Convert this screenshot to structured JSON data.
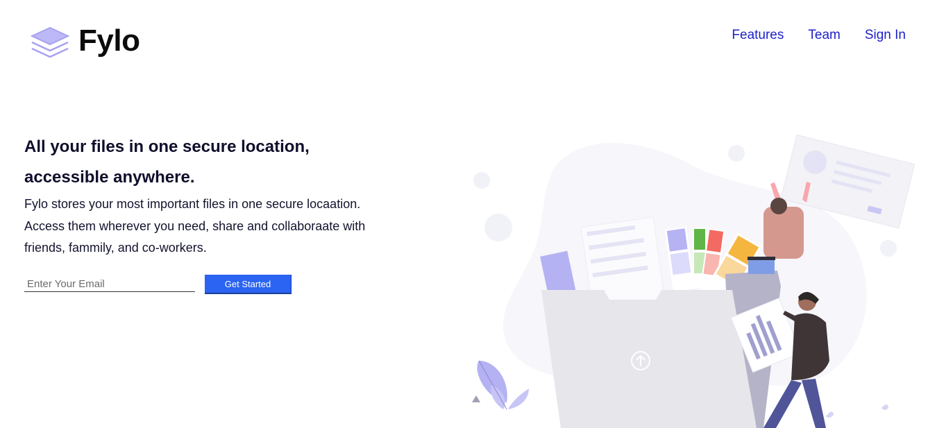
{
  "header": {
    "brand": "Fylo",
    "nav": [
      {
        "label": "Features"
      },
      {
        "label": "Team"
      },
      {
        "label": "Sign In"
      }
    ]
  },
  "hero": {
    "title": "All your files in one secure location, accessible anywhere.",
    "description": "Fylo stores your most important files in one secure locaation. Access them wherever you need, share and collaboraate with friends, fammily, and co-workers."
  },
  "signup": {
    "email_placeholder": "Enter Your Email",
    "email_value": "",
    "button_label": "Get Started"
  },
  "colors": {
    "accent": "#2b63f2",
    "nav_link": "#1b1fc9",
    "heading": "#0f0e2b",
    "logo_icon": "#b8b4f5"
  },
  "icons": {
    "logo": "stacked-layers-icon",
    "upload": "upload-arrow-icon"
  }
}
